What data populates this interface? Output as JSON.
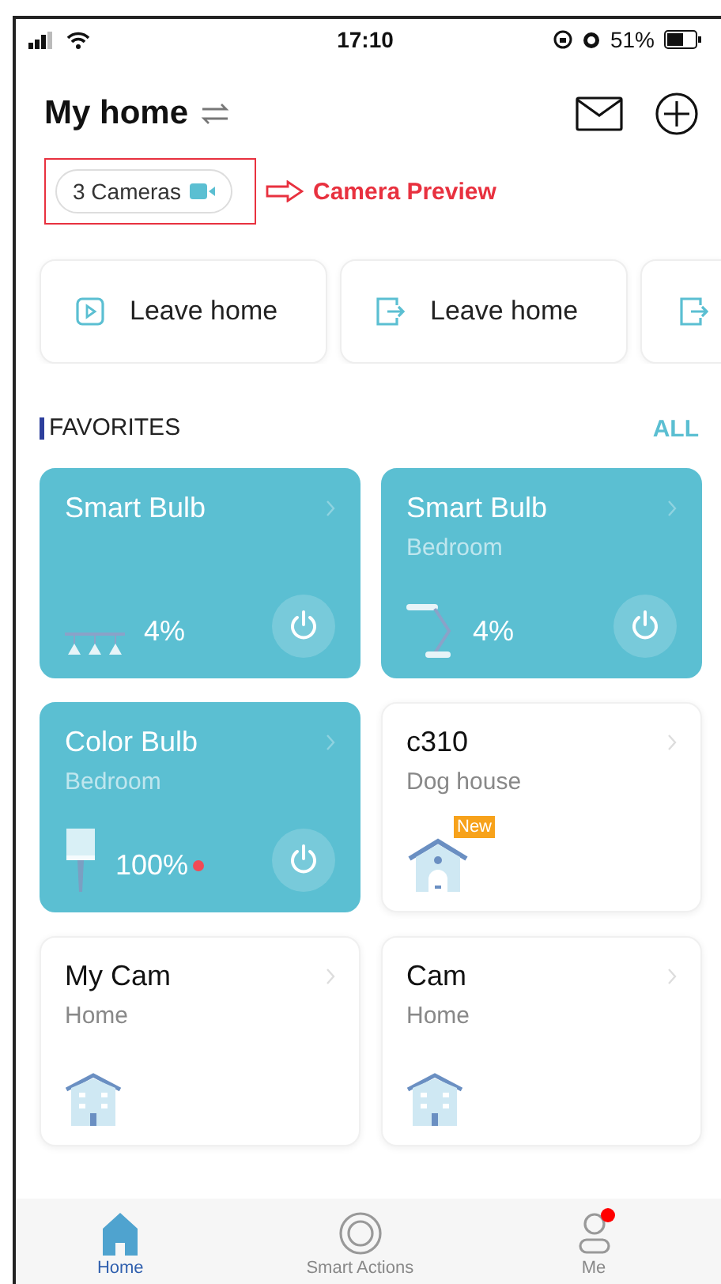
{
  "status_bar": {
    "time": "17:10",
    "battery": "51%"
  },
  "header": {
    "title": "My home"
  },
  "camera_preview": {
    "label": "3 Cameras",
    "annotation": "Camera Preview"
  },
  "scenes": [
    {
      "label": "Leave home",
      "partial": false
    },
    {
      "label": "Leave home",
      "partial": false
    },
    {
      "partial": true
    }
  ],
  "favorites": {
    "title": "FAVORITES",
    "link": "ALL"
  },
  "devices": [
    {
      "kind": "light",
      "name": "Smart Bulb",
      "on": true,
      "reading": "4%",
      "alert": false
    },
    {
      "kind": "light",
      "name": "Smart Bulb",
      "room": "Bedroom",
      "on": true,
      "reading": "4%",
      "alert": false
    },
    {
      "kind": "light",
      "name": "Color Bulb",
      "room": "Bedroom",
      "on": true,
      "reading": "100%",
      "alert": true
    },
    {
      "kind": "camera",
      "name": "c310",
      "room": "Dog house",
      "badge": "New"
    },
    {
      "kind": "camera",
      "name": "My Cam",
      "room": "Home"
    },
    {
      "kind": "camera",
      "name": "Cam",
      "room": "Home"
    }
  ],
  "tabs": [
    {
      "label": "Home",
      "selected": true,
      "badge": false
    },
    {
      "label": "Smart Actions",
      "selected": false,
      "badge": false
    },
    {
      "label": "Me",
      "selected": false,
      "badge": true
    }
  ]
}
